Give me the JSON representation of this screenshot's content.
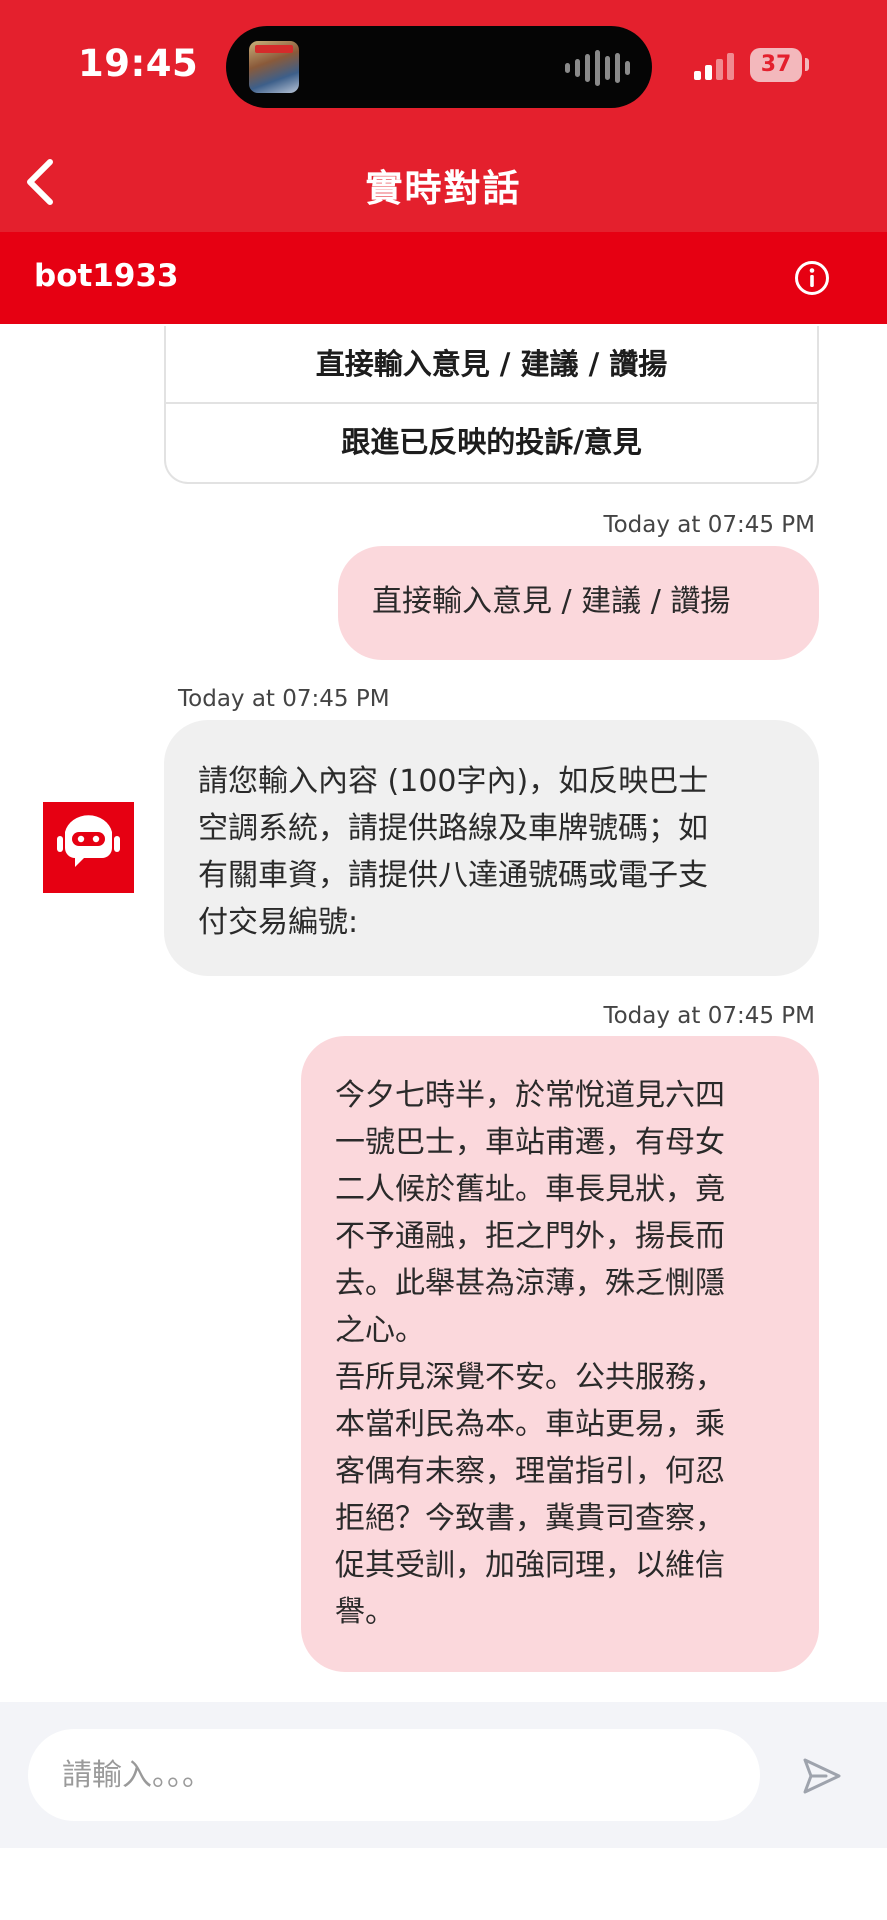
{
  "status_bar": {
    "time": "19:45",
    "battery": "37"
  },
  "header": {
    "title": "實時對話"
  },
  "bot_bar": {
    "name": "bot1933"
  },
  "options": [
    {
      "label": "直接輸入意見 / 建議 / 讚揚"
    },
    {
      "label": "跟進已反映的投訴/意見"
    }
  ],
  "messages": [
    {
      "sender": "user",
      "timestamp": "Today at 07:45 PM",
      "lines": [
        "直接輸入意見 / 建議 / 讚揚"
      ]
    },
    {
      "sender": "bot",
      "timestamp": "Today at 07:45 PM",
      "lines": [
        "請您輸入內容 (100字內)，如反映巴士",
        "空調系統，請提供路線及車牌號碼；如",
        "有關車資，請提供八達通號碼或電子支",
        "付交易編號:"
      ]
    },
    {
      "sender": "user",
      "timestamp": "Today at 07:45 PM",
      "lines": [
        "今夕七時半，於常悅道見六四",
        "一號巴士，車站甫遷，有母女",
        "二人候於舊址。車長見狀，竟",
        "不予通融，拒之門外，揚長而",
        "去。此舉甚為涼薄，殊乏惻隱",
        "之心。",
        "吾所見深覺不安。公共服務，",
        "本當利民為本。車站更易，乘",
        "客偶有未察，理當指引，何忍",
        "拒絕？今致書，冀貴司查察，",
        "促其受訓，加強同理，以維信",
        "譽。"
      ]
    }
  ],
  "input": {
    "placeholder": "請輸入。。。",
    "value": ""
  },
  "icons": {
    "back": "chevron-left-icon",
    "info": "info-icon",
    "avatar": "robot-chat-icon",
    "send": "send-icon"
  },
  "colors": {
    "brand_red": "#e4202d",
    "bar_red": "#e60012",
    "user_bubble": "#fbd8dc",
    "bot_bubble": "#f0f0f0"
  }
}
